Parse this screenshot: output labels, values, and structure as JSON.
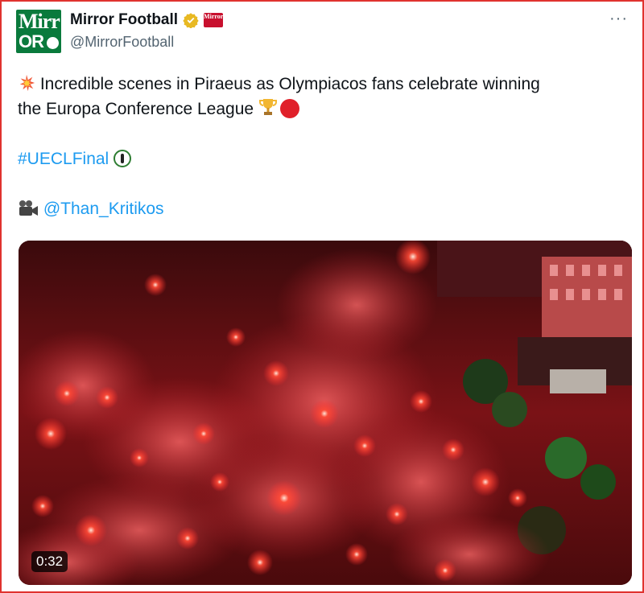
{
  "author": {
    "name": "Mirror Football",
    "handle": "@MirrorFootball",
    "avatar_text_top": "Mirr",
    "avatar_text_bottom": "OR",
    "badge_text": "Mirror",
    "verified_color": "#e8b923"
  },
  "menu": {
    "more_label": "···"
  },
  "tweet": {
    "line1": "Incredible scenes in Piraeus as Olympiacos fans celebrate winning",
    "line2": "the Europa Conference League",
    "hashtag": "#UECLFinal",
    "mention": "@Than_Kritikos",
    "icons": [
      "collision-icon",
      "trophy-icon",
      "red-circle-icon",
      "conference-league-trophy-icon",
      "movie-camera-icon"
    ]
  },
  "media": {
    "type": "video",
    "duration": "0:32",
    "description_colors": {
      "flare": "#ff3a2a",
      "smoke": "#d8303a",
      "dark": "#2a0506"
    }
  },
  "colors": {
    "link": "#1d9bf0",
    "frame_border": "#e0322f",
    "avatar_bg": "#0a7a3c"
  }
}
